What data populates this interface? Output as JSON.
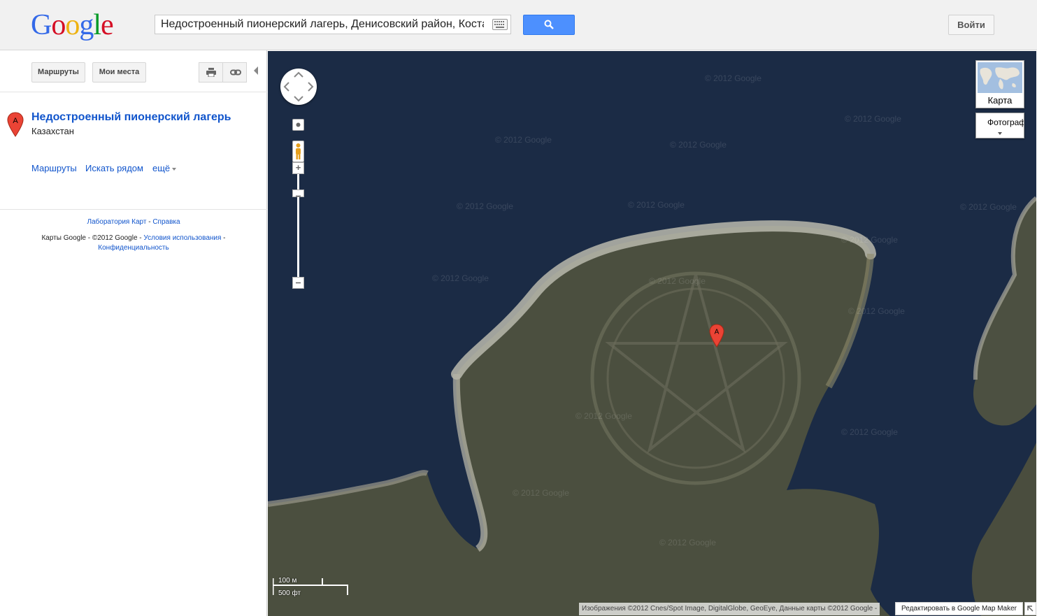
{
  "header": {
    "logo": [
      "G",
      "o",
      "o",
      "g",
      "l",
      "e"
    ],
    "logo_colors": [
      "#3369e8",
      "#d50f25",
      "#eeb211",
      "#3369e8",
      "#009925",
      "#d50f25"
    ],
    "search_value": "Недостроенный пионерский лагерь, Денисовский район, Костанайская",
    "keyboard_icon": "keyboard-icon",
    "search_button_icon": "search-icon",
    "signin_label": "Войти"
  },
  "sidebar": {
    "routes_button": "Маршруты",
    "my_places_button": "Мои места",
    "print_icon": "print-icon",
    "link_icon": "link-icon",
    "result": {
      "marker": "A",
      "title": "Недостроенный пионерский лагерь",
      "subtitle": "Казахстан"
    },
    "actions": {
      "routes": "Маршруты",
      "search_nearby": "Искать рядом",
      "more": "ещё"
    },
    "footer": {
      "labs": "Лаборатория Карт",
      "sep1": " - ",
      "help": "Справка",
      "copyright": "Карты Google - ©2012 Google - ",
      "terms": "Условия использования",
      "sep2": " -",
      "privacy": "Конфиденциальность"
    }
  },
  "map": {
    "map_type_label": "Карта",
    "satellite_label": "Фотографии",
    "marker": "A",
    "watermark": "© 2012 Google",
    "scale_metric": "100 м",
    "scale_imperial": "500 фт",
    "attribution": "Изображения ©2012 Cnes/Spot Image, DigitalGlobe, GeoEye, Данные карты ©2012 Google -",
    "mapmaker_link": "Редактировать в Google Map Maker",
    "colors": {
      "water": "#1b2b45",
      "land": "#4b4f3f",
      "shore": "#bdbcb0"
    }
  }
}
